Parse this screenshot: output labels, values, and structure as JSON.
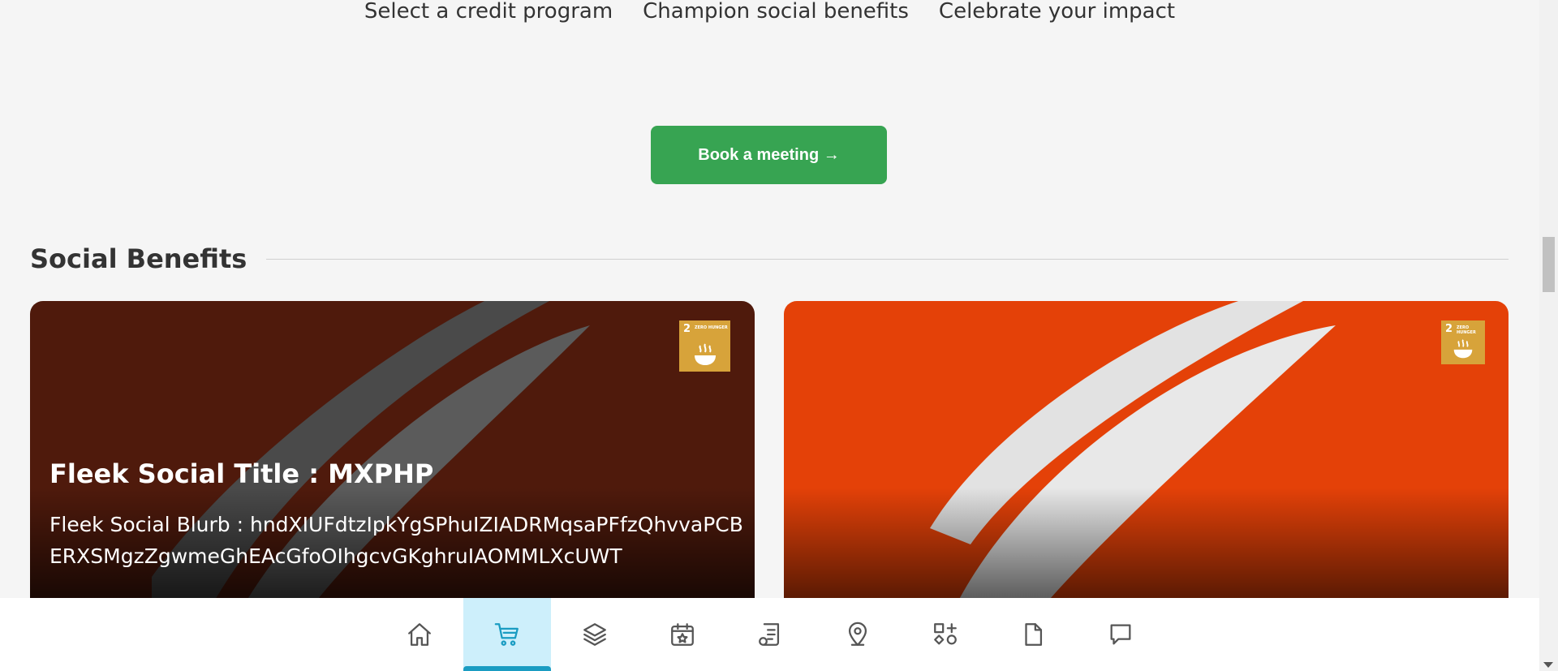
{
  "steps": [
    "Select a credit program",
    "Champion social benefits",
    "Celebrate your impact"
  ],
  "cta": {
    "label": "Book a meeting →"
  },
  "section": {
    "title": "Social Benefits"
  },
  "cards": [
    {
      "title": "Fleek Social Title : MXPHP",
      "blurb": "Fleek Social Blurb : hndXIUFdtzIpkYgSPhuIZIADRMqsaPFfzQhvvaPCBERXSMgzZgwmeGhEAcGfoOIhgcvGKghruIAOMMLXcUWT",
      "badge": {
        "number": "2",
        "text": "ZERO HUNGER",
        "color": "#d7a33a"
      },
      "color": "#4f1a0c"
    },
    {
      "badge": {
        "number": "2",
        "text": "ZERO HUNGER",
        "color": "#d7a33a"
      },
      "color": "#e44108"
    }
  ],
  "nav": {
    "items": [
      "home-icon",
      "cart-icon",
      "layers-icon",
      "calendar-star-icon",
      "document-list-icon",
      "map-pin-icon",
      "shapes-icon",
      "file-icon",
      "chat-icon"
    ],
    "active": "cart-icon",
    "active_color": "#1a9cc2"
  }
}
